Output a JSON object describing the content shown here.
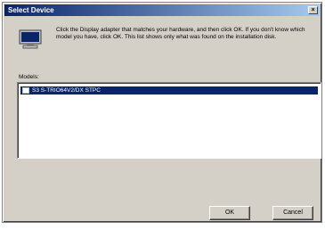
{
  "window": {
    "title": "Select Device",
    "close_glyph": "×"
  },
  "instructions": "Click the Display adapter that matches your hardware, and then click OK. If you don't know which model you have, click OK. This list shows only what was found on the installation disk.",
  "models": {
    "label": "Models:",
    "items": [
      {
        "label": "S3 S-TRIO64V2/DX STPC",
        "selected": true,
        "icon": "display-adapter-icon"
      }
    ]
  },
  "buttons": {
    "ok": "OK",
    "cancel": "Cancel"
  },
  "colors": {
    "title_bar": "#0a246a",
    "selection": "#0a246a",
    "dialog_face": "#d4d0c8"
  }
}
